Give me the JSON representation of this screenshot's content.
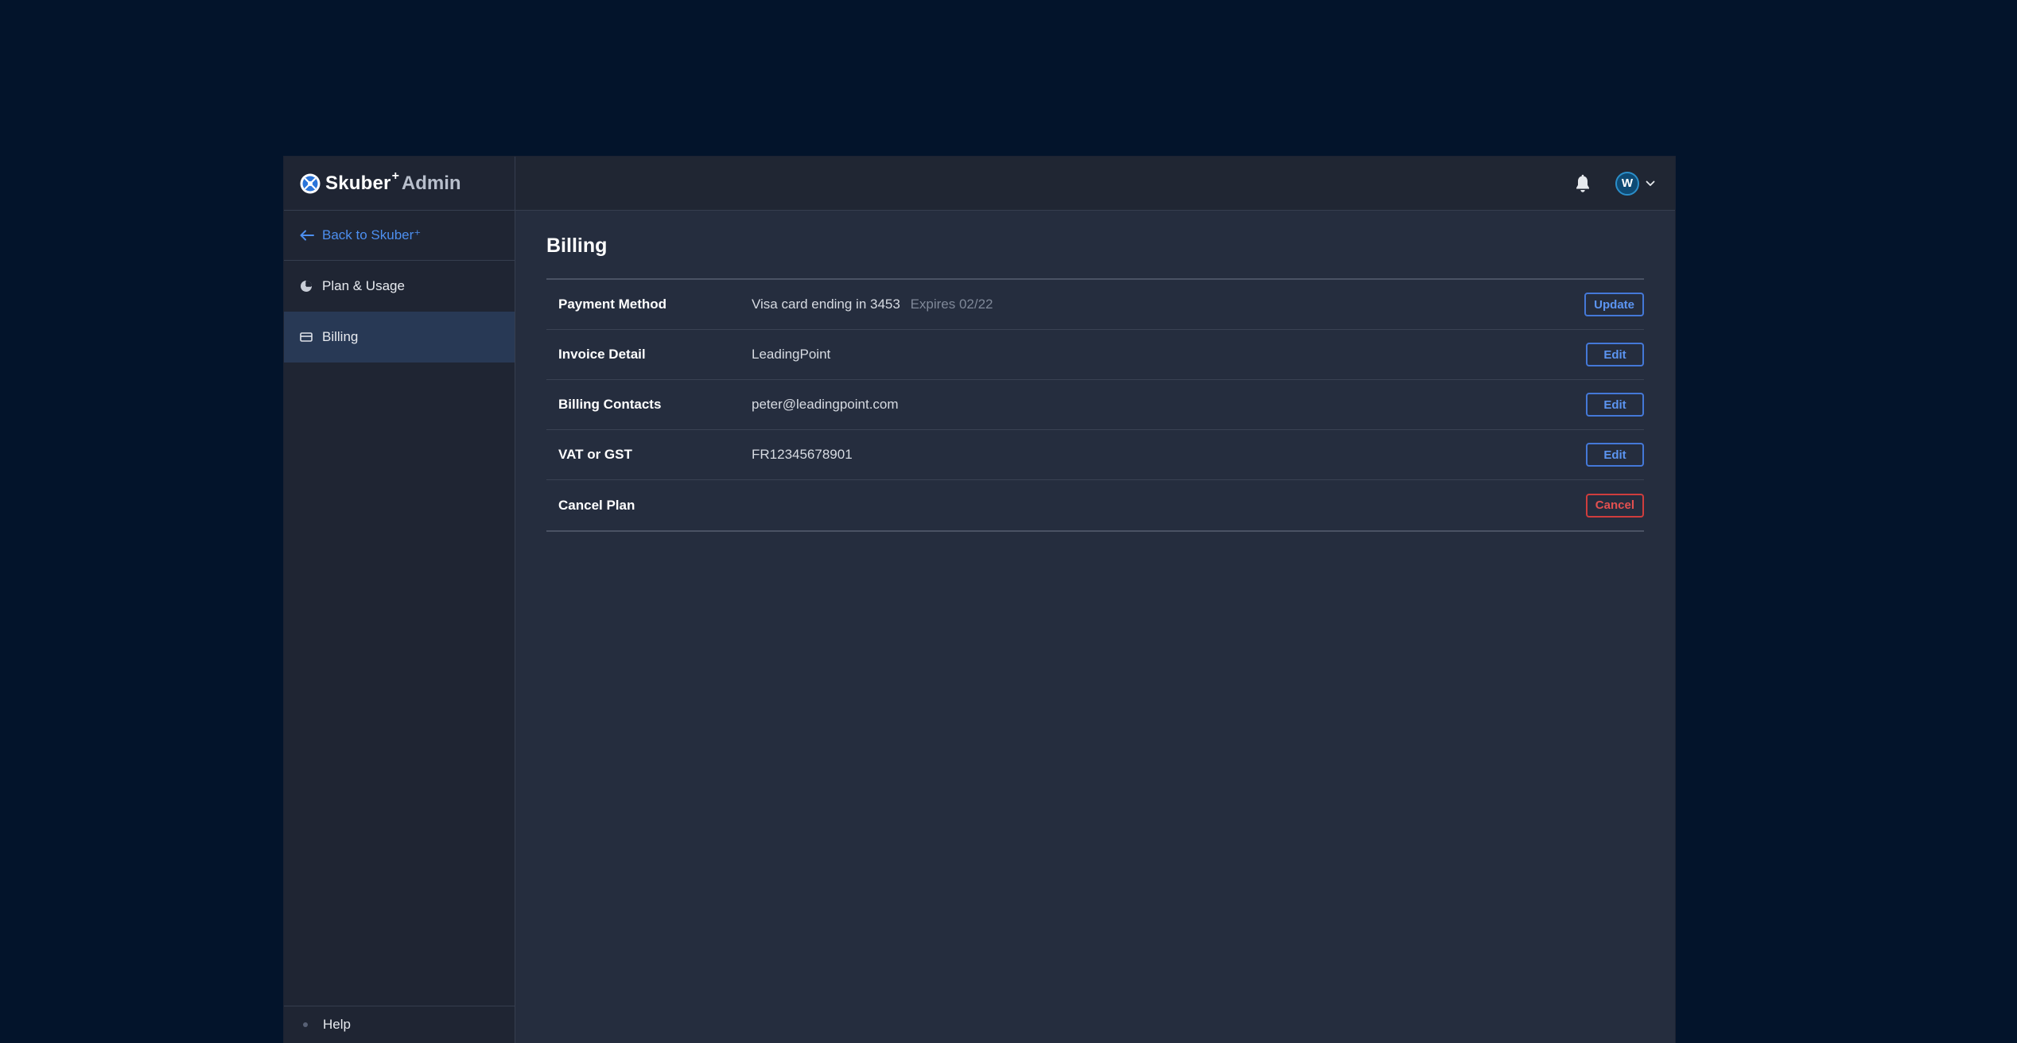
{
  "brand": {
    "name": "Skuber",
    "plus": "+",
    "suffix": "Admin"
  },
  "sidebar": {
    "back_label": "Back to Skuber⁺",
    "items": [
      {
        "label": "Plan & Usage",
        "icon": "pie-chart-icon",
        "active": false
      },
      {
        "label": "Billing",
        "icon": "credit-card-icon",
        "active": true
      }
    ],
    "help_label": "Help"
  },
  "topbar": {
    "notifications_icon": "bell-icon",
    "user": {
      "initial": "W"
    }
  },
  "page": {
    "title": "Billing",
    "rows": [
      {
        "label": "Payment Method",
        "value": "Visa card ending in 3453",
        "sub": "Expires 02/22",
        "action": "Update"
      },
      {
        "label": "Invoice Detail",
        "value": "LeadingPoint",
        "sub": "",
        "action": "Edit"
      },
      {
        "label": "Billing Contacts",
        "value": "peter@leadingpoint.com",
        "sub": "",
        "action": "Edit"
      },
      {
        "label": "VAT or GST",
        "value": "FR12345678901",
        "sub": "",
        "action": "Edit"
      },
      {
        "label": "Cancel Plan",
        "value": "",
        "sub": "",
        "action": "Cancel"
      }
    ]
  },
  "colors": {
    "background": "#03142b",
    "accent": "#4d8ff0",
    "danger": "#e35050",
    "active_nav": "#283955"
  }
}
